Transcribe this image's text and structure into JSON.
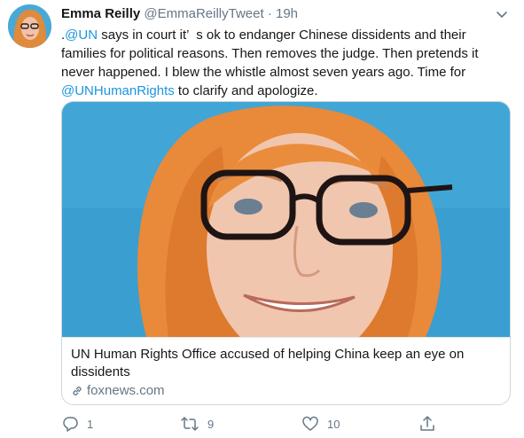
{
  "tweet": {
    "name": "Emma Reilly",
    "handle": "@EmmaReillyTweet",
    "separator": "·",
    "time": "19h",
    "text": {
      "p1": ".",
      "mention1": "@UN",
      "p2": " says in court it’  s ok to endanger Chinese dissidents and their families for political reasons. Then removes the judge. Then pretends it never happened. I blew the whistle almost seven years ago. Time for ",
      "mention2": "@UNHumanRights",
      "p3": " to clarify and apologize."
    }
  },
  "card": {
    "title": "UN Human Rights Office accused of helping China keep an eye on dissidents",
    "source": "foxnews.com"
  },
  "actions": {
    "reply_count": "1",
    "retweet_count": "9",
    "like_count": "10"
  },
  "icons": [
    "caret-down-icon",
    "reply-icon",
    "retweet-icon",
    "like-icon",
    "share-icon",
    "link-icon"
  ],
  "colors": {
    "link": "#1b95e0",
    "secondary": "#657786",
    "border": "#ccd6dd"
  }
}
